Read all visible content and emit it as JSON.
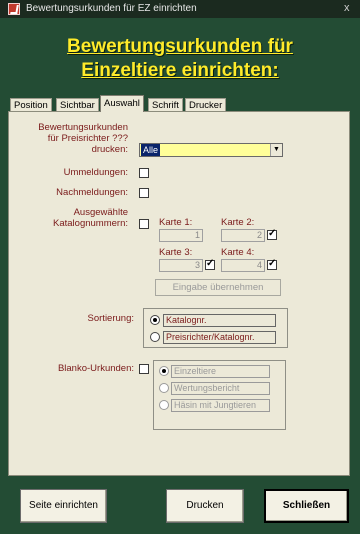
{
  "window": {
    "title": "Bewertungsurkunden für EZ einrichten",
    "close_symbol": "x"
  },
  "heading": {
    "line1": "Bewertungsurkunden für",
    "line2": "Einzeltiere einrichten:"
  },
  "tabs": [
    {
      "label": "Position"
    },
    {
      "label": "Sichtbar"
    },
    {
      "label": "Auswahl",
      "active": true
    },
    {
      "label": "Schrift"
    },
    {
      "label": "Drucker"
    }
  ],
  "form": {
    "preisrichter_label_1": "Bewertungsurkunden",
    "preisrichter_label_2": "für Preisrichter ???",
    "preisrichter_label_3": "drucken:",
    "preisrichter_value": "Alle",
    "ummeldungen_label": "Ummeldungen:",
    "nachmeldungen_label": "Nachmeldungen:",
    "katalog_label_1": "Ausgewählte",
    "katalog_label_2": "Katalognummern:",
    "karten": [
      {
        "label": "Karte 1:",
        "value": "1",
        "checked": false
      },
      {
        "label": "Karte 2:",
        "value": "2",
        "checked": true
      },
      {
        "label": "Karte 3:",
        "value": "3",
        "checked": true
      },
      {
        "label": "Karte 4:",
        "value": "4",
        "checked": true
      }
    ],
    "eingabe_button": "Eingabe übernehmen",
    "sortierung_label": "Sortierung:",
    "sortierung_options": [
      {
        "label": "Katalognr.",
        "selected": true
      },
      {
        "label": "Preisrichter/Katalognr.",
        "selected": false
      }
    ],
    "blanko_label": "Blanko-Urkunden:",
    "blanko_options": [
      {
        "label": "Einzeltiere",
        "selected": true
      },
      {
        "label": "Wertungsbericht",
        "selected": false
      },
      {
        "label": "Häsin mit Jungtieren",
        "selected": false
      }
    ]
  },
  "buttons": {
    "seite": "Seite einrichten",
    "drucken": "Drucken",
    "schliessen": "Schließen"
  },
  "colors": {
    "background": "#234c34",
    "heading": "#ffeb2a",
    "label": "#7a1a1a",
    "combo": "#ffff99"
  }
}
